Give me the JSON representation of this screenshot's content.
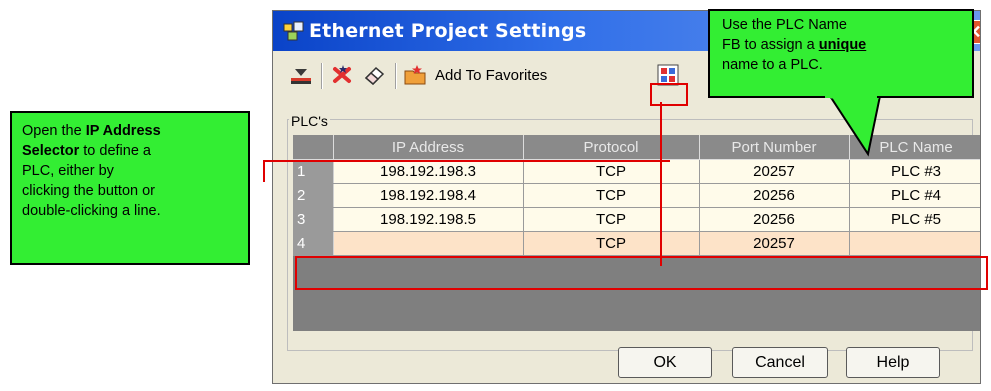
{
  "dialog": {
    "title": "Ethernet Project Settings",
    "close_glyph": "✕"
  },
  "toolbar": {
    "add_to_favorites_label": "Add To Favorites"
  },
  "plc_group": {
    "label": "PLC's",
    "columns": [
      "",
      "IP Address",
      "Protocol",
      "Port Number",
      "PLC Name"
    ],
    "rows": [
      {
        "num": "1",
        "ip": "198.192.198.3",
        "protocol": "TCP",
        "port": "20257",
        "name": "PLC #3"
      },
      {
        "num": "2",
        "ip": "198.192.198.4",
        "protocol": "TCP",
        "port": "20256",
        "name": "PLC #4"
      },
      {
        "num": "3",
        "ip": "198.192.198.5",
        "protocol": "TCP",
        "port": "20256",
        "name": "PLC #5"
      },
      {
        "num": "4",
        "ip": "",
        "protocol": "TCP",
        "port": "20257",
        "name": ""
      }
    ]
  },
  "buttons": {
    "ok": "OK",
    "cancel": "Cancel",
    "help": "Help"
  },
  "callouts": {
    "left": {
      "t1": "Open the ",
      "b1": "IP Address",
      "b2": "Selector",
      "t2": " to define a",
      "t3": "PLC, either by",
      "t4": "clicking the button or",
      "t5": "double-clicking a line."
    },
    "right": {
      "t1": "Use the PLC Name",
      "t2": "FB to assign a ",
      "u1": "unique",
      "t3": "name to a PLC."
    }
  },
  "colors": {
    "callout_fill": "#33ee33",
    "highlight_red": "#e00000",
    "selected_row": "#fde3c8",
    "row_fill": "#fffbea"
  },
  "icons": [
    "app-icon",
    "download-icon",
    "delete-icon",
    "eraser-icon",
    "folder-star-icon",
    "ip-selector-icon"
  ]
}
